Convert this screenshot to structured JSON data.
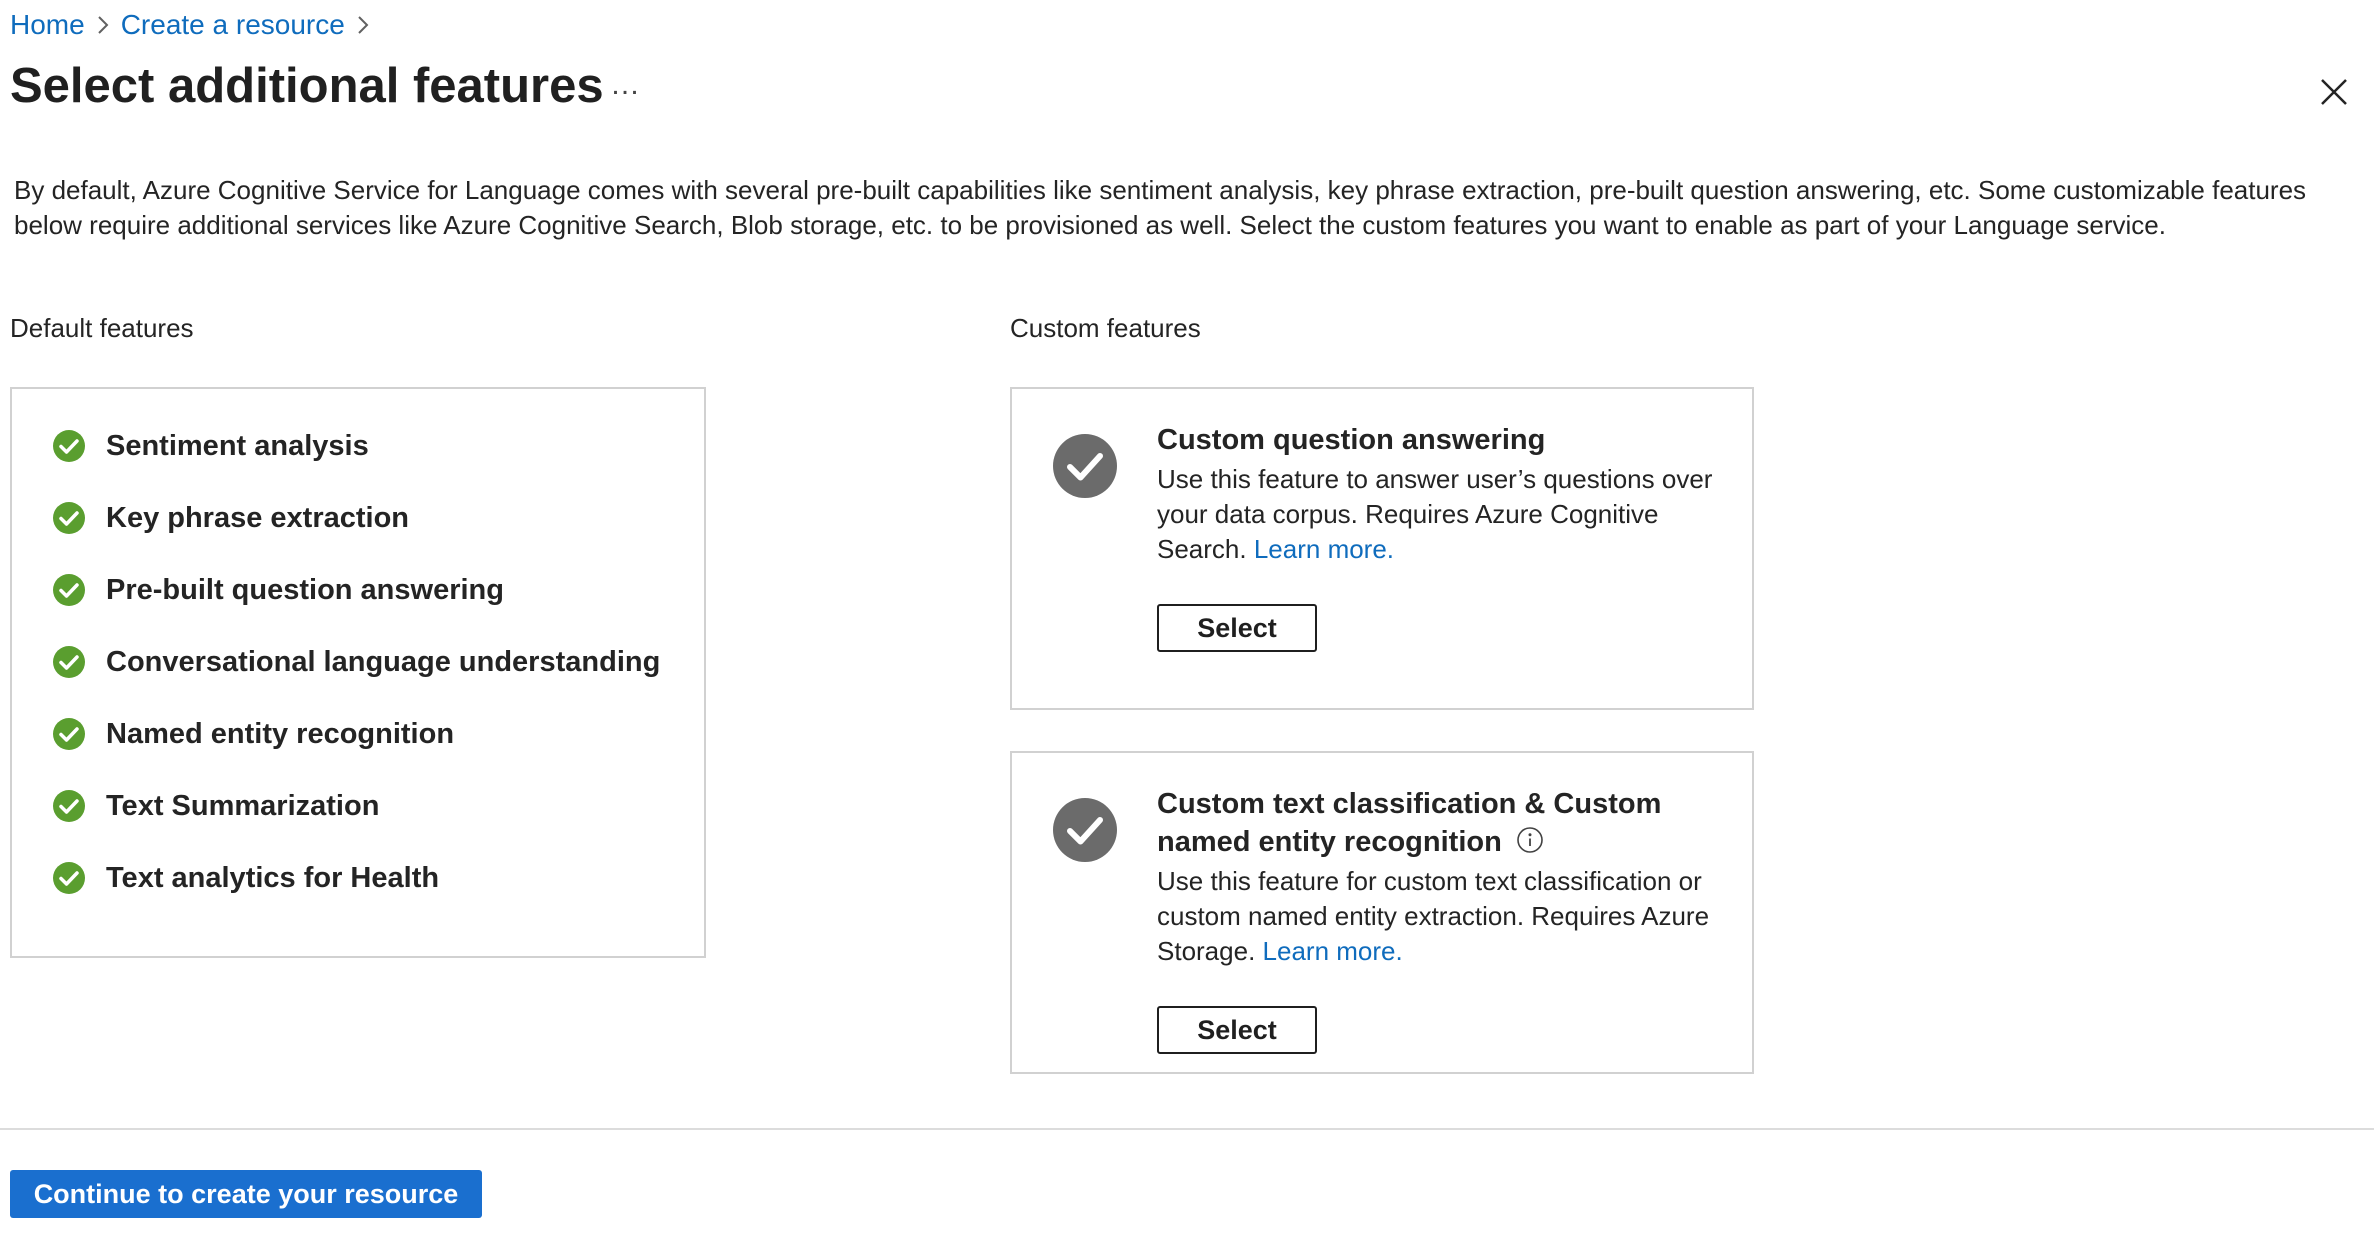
{
  "breadcrumb": {
    "items": [
      {
        "label": "Home"
      },
      {
        "label": "Create a resource"
      }
    ]
  },
  "header": {
    "title": "Select additional features",
    "more_label": "…"
  },
  "description": "By default, Azure Cognitive Service for Language comes with several pre-built capabilities like sentiment analysis, key phrase extraction, pre-built question answering, etc. Some customizable features below require additional services like Azure Cognitive Search, Blob storage, etc. to be provisioned as well. Select the custom features you want to enable as part of your Language service.",
  "default_features": {
    "label": "Default features",
    "items": [
      {
        "label": "Sentiment analysis"
      },
      {
        "label": "Key phrase extraction"
      },
      {
        "label": "Pre-built question answering"
      },
      {
        "label": "Conversational language understanding"
      },
      {
        "label": "Named entity recognition"
      },
      {
        "label": "Text Summarization"
      },
      {
        "label": "Text analytics for Health"
      }
    ]
  },
  "custom_features": {
    "label": "Custom features",
    "cards": [
      {
        "title": "Custom question answering",
        "description": "Use this feature to answer user’s questions over your data corpus. Requires Azure Cognitive Search.",
        "link": "Learn more.",
        "button": "Select"
      },
      {
        "title": "Custom text classification & Custom named entity recognition",
        "description": "Use this feature for custom text classification or custom named entity extraction. Requires Azure Storage.",
        "link": "Learn more.",
        "button": "Select"
      }
    ]
  },
  "footer": {
    "primary_button": "Continue to create your resource"
  },
  "colors": {
    "link": "#0f6cbd",
    "check_green": "#5a9e2f",
    "check_grey": "#6b6b6b",
    "primary": "#1a6fcf"
  }
}
